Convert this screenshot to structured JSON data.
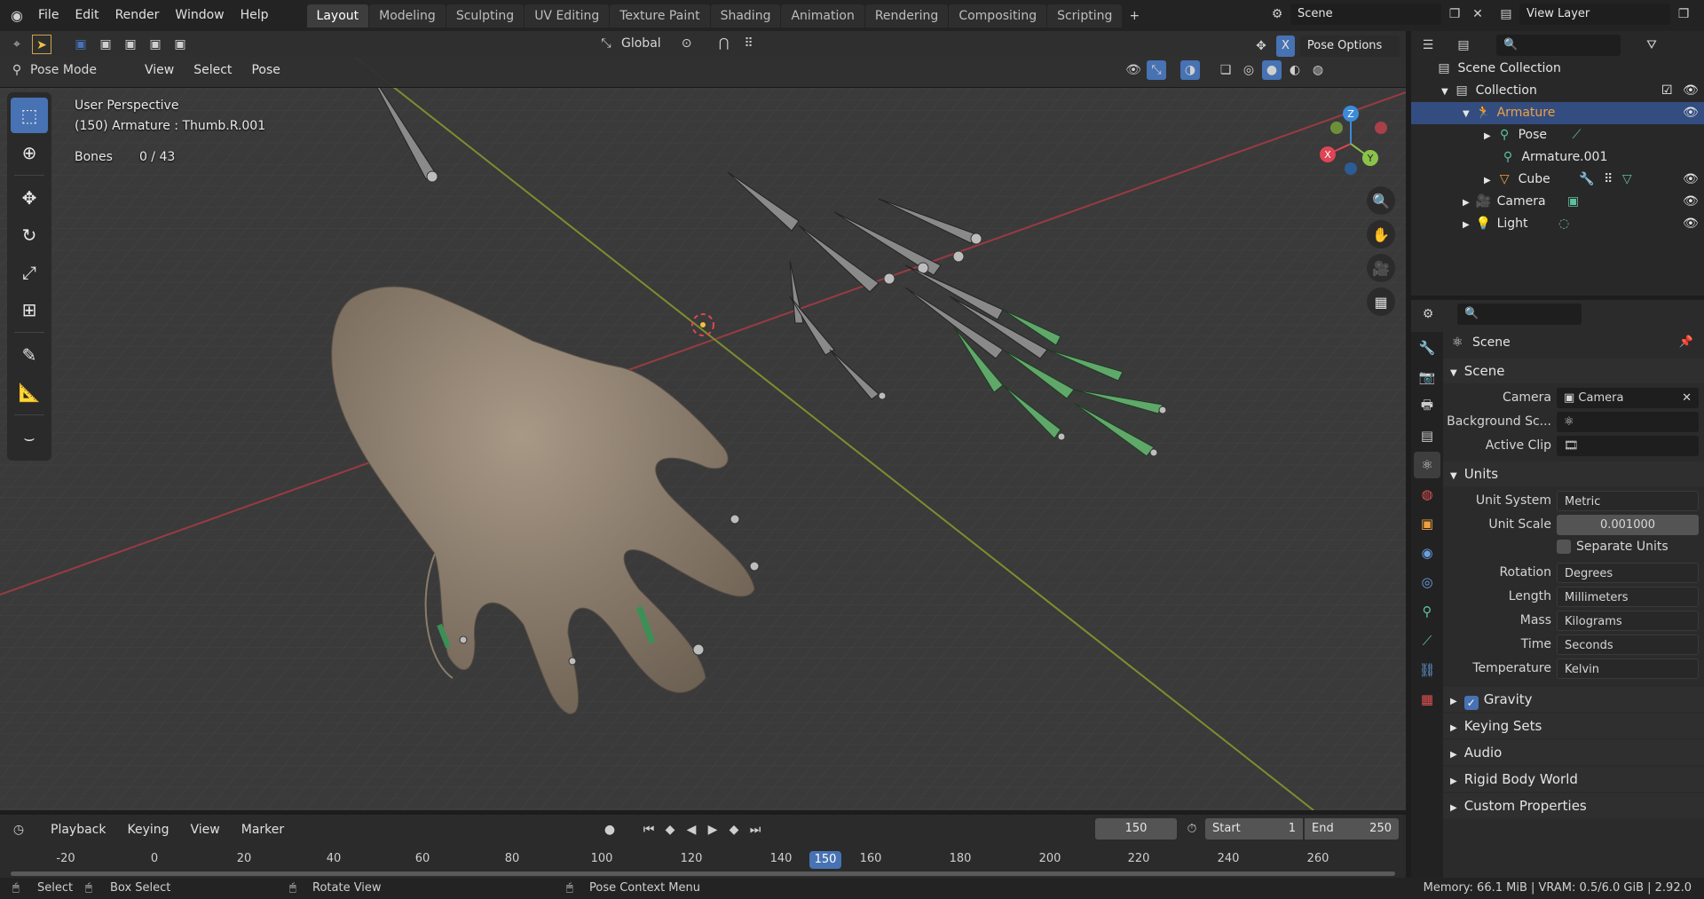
{
  "menus": [
    "File",
    "Edit",
    "Render",
    "Window",
    "Help"
  ],
  "workspaces": [
    "Layout",
    "Modeling",
    "Sculpting",
    "UV Editing",
    "Texture Paint",
    "Shading",
    "Animation",
    "Rendering",
    "Compositing",
    "Scripting"
  ],
  "active_workspace": "Layout",
  "scene_name": "Scene",
  "view_layer": "View Layer",
  "header": {
    "transform_orientation": "Global",
    "pose_options": "Pose Options",
    "mode": "Pose Mode",
    "view": "View",
    "select": "Select",
    "pose": "Pose",
    "x_mirror": "X"
  },
  "viewport": {
    "perspective": "User Perspective",
    "context": "(150) Armature : Thumb.R.001",
    "bones_label": "Bones",
    "bones_value": "0 / 43"
  },
  "gizmo": {
    "x": "X",
    "y": "Y",
    "z": "Z"
  },
  "outliner": {
    "scene_collection": "Scene Collection",
    "items": [
      {
        "label": "Collection"
      },
      {
        "label": "Armature"
      },
      {
        "label": "Pose"
      },
      {
        "label": "Armature.001"
      },
      {
        "label": "Cube"
      },
      {
        "label": "Camera"
      },
      {
        "label": "Light"
      }
    ]
  },
  "properties": {
    "context_title": "Scene",
    "scene_panel": "Scene",
    "camera_label": "Camera",
    "camera_value": "Camera",
    "background_label": "Background Sc...",
    "active_clip_label": "Active Clip",
    "units_panel": "Units",
    "unit_system_label": "Unit System",
    "unit_system_value": "Metric",
    "unit_scale_label": "Unit Scale",
    "unit_scale_value": "0.001000",
    "separate_units": "Separate Units",
    "rotation_label": "Rotation",
    "rotation_value": "Degrees",
    "length_label": "Length",
    "length_value": "Millimeters",
    "mass_label": "Mass",
    "mass_value": "Kilograms",
    "time_label": "Time",
    "time_value": "Seconds",
    "temperature_label": "Temperature",
    "temperature_value": "Kelvin",
    "gravity": "Gravity",
    "keying_sets": "Keying Sets",
    "audio": "Audio",
    "rigid_body_world": "Rigid Body World",
    "custom_properties": "Custom Properties"
  },
  "timeline": {
    "playback": "Playback",
    "keying": "Keying",
    "view": "View",
    "marker": "Marker",
    "current_frame": "150",
    "start_label": "Start",
    "start_value": "1",
    "end_label": "End",
    "end_value": "250",
    "ticks": [
      "-20",
      "0",
      "20",
      "40",
      "60",
      "80",
      "100",
      "120",
      "140",
      "150",
      "160",
      "180",
      "200",
      "220",
      "240",
      "260"
    ]
  },
  "status": {
    "select": "Select",
    "box_select": "Box Select",
    "rotate_view": "Rotate View",
    "context_menu": "Pose Context Menu",
    "memory": "Memory: 66.1 MiB | VRAM: 0.5/6.0 GiB | 2.92.0"
  },
  "colors": {
    "accent": "#4772b3",
    "bone_selected": "#5fa86a",
    "skin": "#8c7e6e",
    "x_axis": "#e04555",
    "y_axis": "#8bc34a",
    "z_axis": "#3d8bd8"
  }
}
